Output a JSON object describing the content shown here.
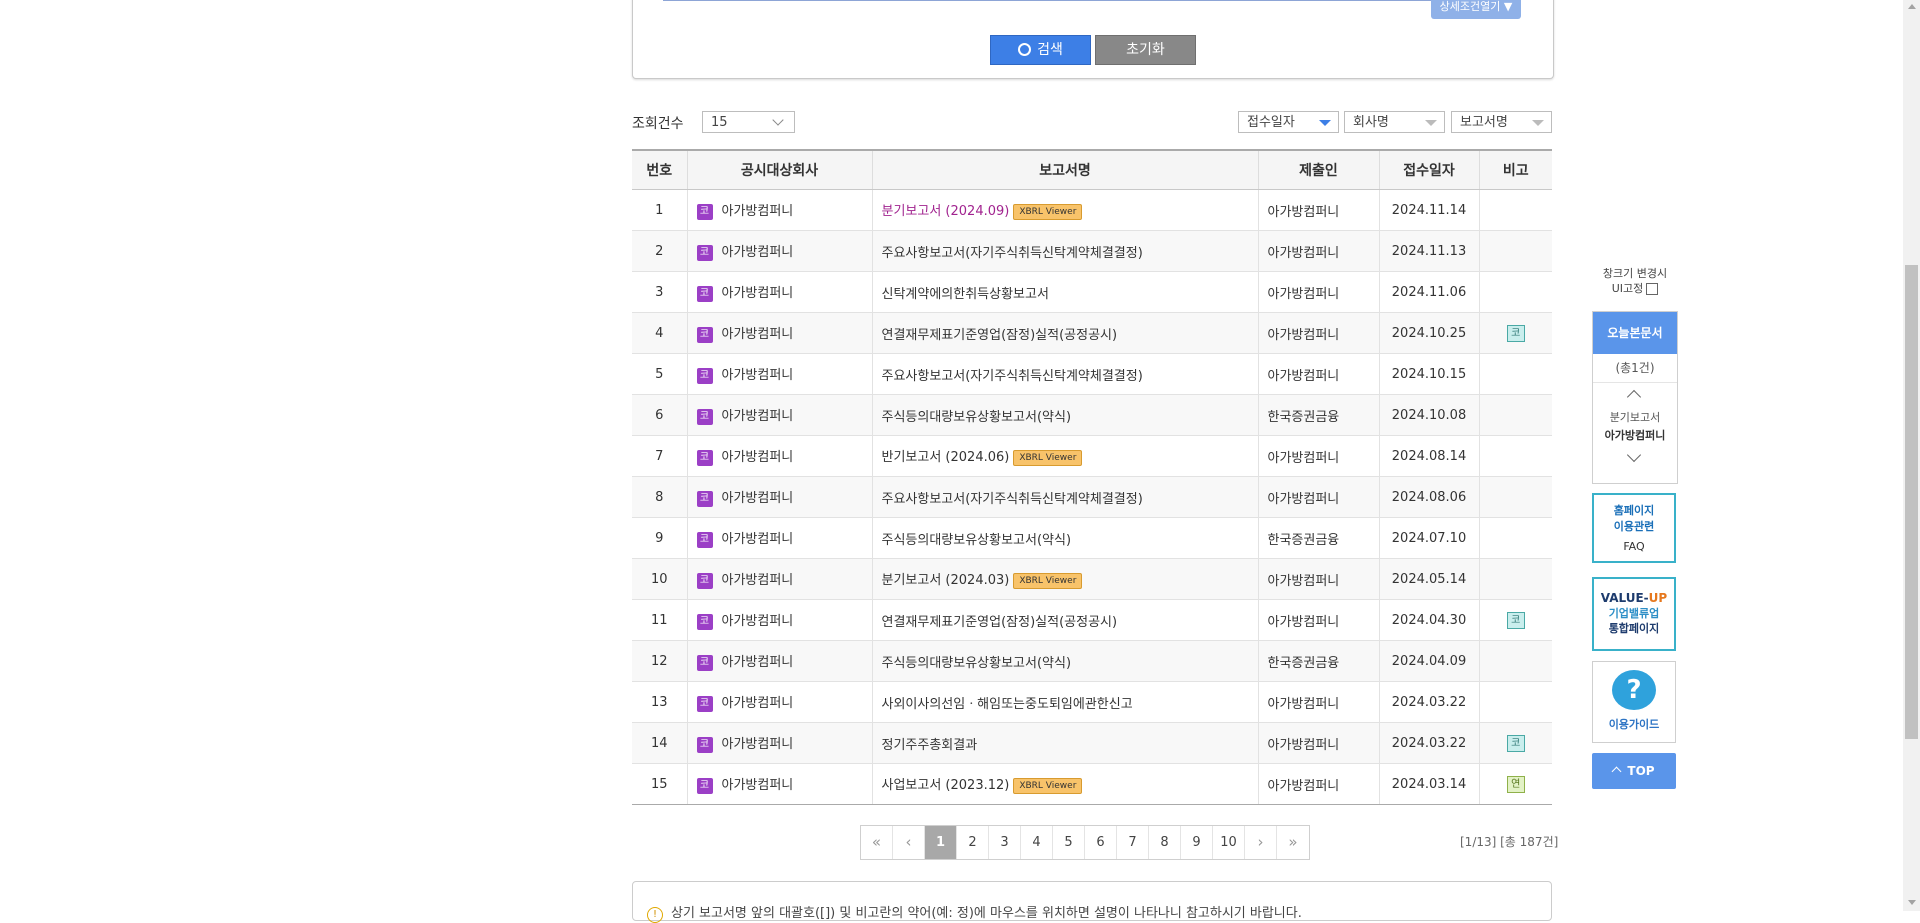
{
  "search": {
    "detail_toggle": "상세조건열기 ▼",
    "search_button": "검색",
    "reset_button": "초기화"
  },
  "controls": {
    "count_label": "조회건수",
    "count_value": "15",
    "sort_date": "접수일자",
    "sort_company": "회사명",
    "sort_report": "보고서명"
  },
  "table": {
    "headers": [
      "번호",
      "공시대상회사",
      "보고서명",
      "제출인",
      "접수일자",
      "비고"
    ],
    "rows": [
      {
        "no": "1",
        "corp_badge": "코",
        "company": "아가방컴퍼니",
        "report": "분기보고서 (2024.09)",
        "xbrl": "XBRL Viewer",
        "submitter": "아가방컴퍼니",
        "date": "2024.11.14",
        "note": ""
      },
      {
        "no": "2",
        "corp_badge": "코",
        "company": "아가방컴퍼니",
        "report": "주요사항보고서(자기주식취득신탁계약체결결정)",
        "xbrl": "",
        "submitter": "아가방컴퍼니",
        "date": "2024.11.13",
        "note": ""
      },
      {
        "no": "3",
        "corp_badge": "코",
        "company": "아가방컴퍼니",
        "report": "신탁계약에의한취득상황보고서",
        "xbrl": "",
        "submitter": "아가방컴퍼니",
        "date": "2024.11.06",
        "note": ""
      },
      {
        "no": "4",
        "corp_badge": "코",
        "company": "아가방컴퍼니",
        "report": "연결재무제표기준영업(잠정)실적(공정공시)",
        "xbrl": "",
        "submitter": "아가방컴퍼니",
        "date": "2024.10.25",
        "note": "코"
      },
      {
        "no": "5",
        "corp_badge": "코",
        "company": "아가방컴퍼니",
        "report": "주요사항보고서(자기주식취득신탁계약체결결정)",
        "xbrl": "",
        "submitter": "아가방컴퍼니",
        "date": "2024.10.15",
        "note": ""
      },
      {
        "no": "6",
        "corp_badge": "코",
        "company": "아가방컴퍼니",
        "report": "주식등의대량보유상황보고서(약식)",
        "xbrl": "",
        "submitter": "한국증권금융",
        "date": "2024.10.08",
        "note": ""
      },
      {
        "no": "7",
        "corp_badge": "코",
        "company": "아가방컴퍼니",
        "report": "반기보고서 (2024.06)",
        "xbrl": "XBRL Viewer",
        "submitter": "아가방컴퍼니",
        "date": "2024.08.14",
        "note": ""
      },
      {
        "no": "8",
        "corp_badge": "코",
        "company": "아가방컴퍼니",
        "report": "주요사항보고서(자기주식취득신탁계약체결결정)",
        "xbrl": "",
        "submitter": "아가방컴퍼니",
        "date": "2024.08.06",
        "note": ""
      },
      {
        "no": "9",
        "corp_badge": "코",
        "company": "아가방컴퍼니",
        "report": "주식등의대량보유상황보고서(약식)",
        "xbrl": "",
        "submitter": "한국증권금융",
        "date": "2024.07.10",
        "note": ""
      },
      {
        "no": "10",
        "corp_badge": "코",
        "company": "아가방컴퍼니",
        "report": "분기보고서 (2024.03)",
        "xbrl": "XBRL Viewer",
        "submitter": "아가방컴퍼니",
        "date": "2024.05.14",
        "note": ""
      },
      {
        "no": "11",
        "corp_badge": "코",
        "company": "아가방컴퍼니",
        "report": "연결재무제표기준영업(잠정)실적(공정공시)",
        "xbrl": "",
        "submitter": "아가방컴퍼니",
        "date": "2024.04.30",
        "note": "코"
      },
      {
        "no": "12",
        "corp_badge": "코",
        "company": "아가방컴퍼니",
        "report": "주식등의대량보유상황보고서(약식)",
        "xbrl": "",
        "submitter": "한국증권금융",
        "date": "2024.04.09",
        "note": ""
      },
      {
        "no": "13",
        "corp_badge": "코",
        "company": "아가방컴퍼니",
        "report": "사외이사의선임ㆍ해임또는중도퇴임에관한신고",
        "xbrl": "",
        "submitter": "아가방컴퍼니",
        "date": "2024.03.22",
        "note": ""
      },
      {
        "no": "14",
        "corp_badge": "코",
        "company": "아가방컴퍼니",
        "report": "정기주주총회결과",
        "xbrl": "",
        "submitter": "아가방컴퍼니",
        "date": "2024.03.22",
        "note": "코"
      },
      {
        "no": "15",
        "corp_badge": "코",
        "company": "아가방컴퍼니",
        "report": "사업보고서 (2023.12)",
        "xbrl": "XBRL Viewer",
        "submitter": "아가방컴퍼니",
        "date": "2024.03.14",
        "note": "연"
      }
    ]
  },
  "pagination": {
    "first": "«",
    "prev": "‹",
    "pages": [
      "1",
      "2",
      "3",
      "4",
      "5",
      "6",
      "7",
      "8",
      "9",
      "10"
    ],
    "current": "1",
    "next": "›",
    "last": "»",
    "info": "[1/13] [총 187건]"
  },
  "notice": {
    "text": "상기 보고서명 앞의 대괄호([]) 및 비고란의 약어(예: 정)에 마우스를 위치하면 설명이 나타나니 참고하시기 바랍니다."
  },
  "sidebar": {
    "fix_label_line1": "창크기 변경시",
    "fix_label_line2": "UI고정",
    "today_title": "오늘본문서",
    "today_count": "(총1건)",
    "today_item_type": "분기보고서",
    "today_item_company": "아가방컴퍼니",
    "faq_line1": "홈페이지",
    "faq_line2": "이용관련",
    "faq_line3": "FAQ",
    "value_line1a": "VALUE-",
    "value_line1b": "UP",
    "value_line2": "기업밸류업",
    "value_line3": "통합페이지",
    "guide_label": "이용가이드",
    "top_label": "TOP"
  },
  "colors": {
    "accent_blue": "#3d7fe6",
    "corp_badge_purple": "#9b3fc6",
    "xbrl_badge": "#f8c36a",
    "new_report_link": "#a1238f"
  }
}
